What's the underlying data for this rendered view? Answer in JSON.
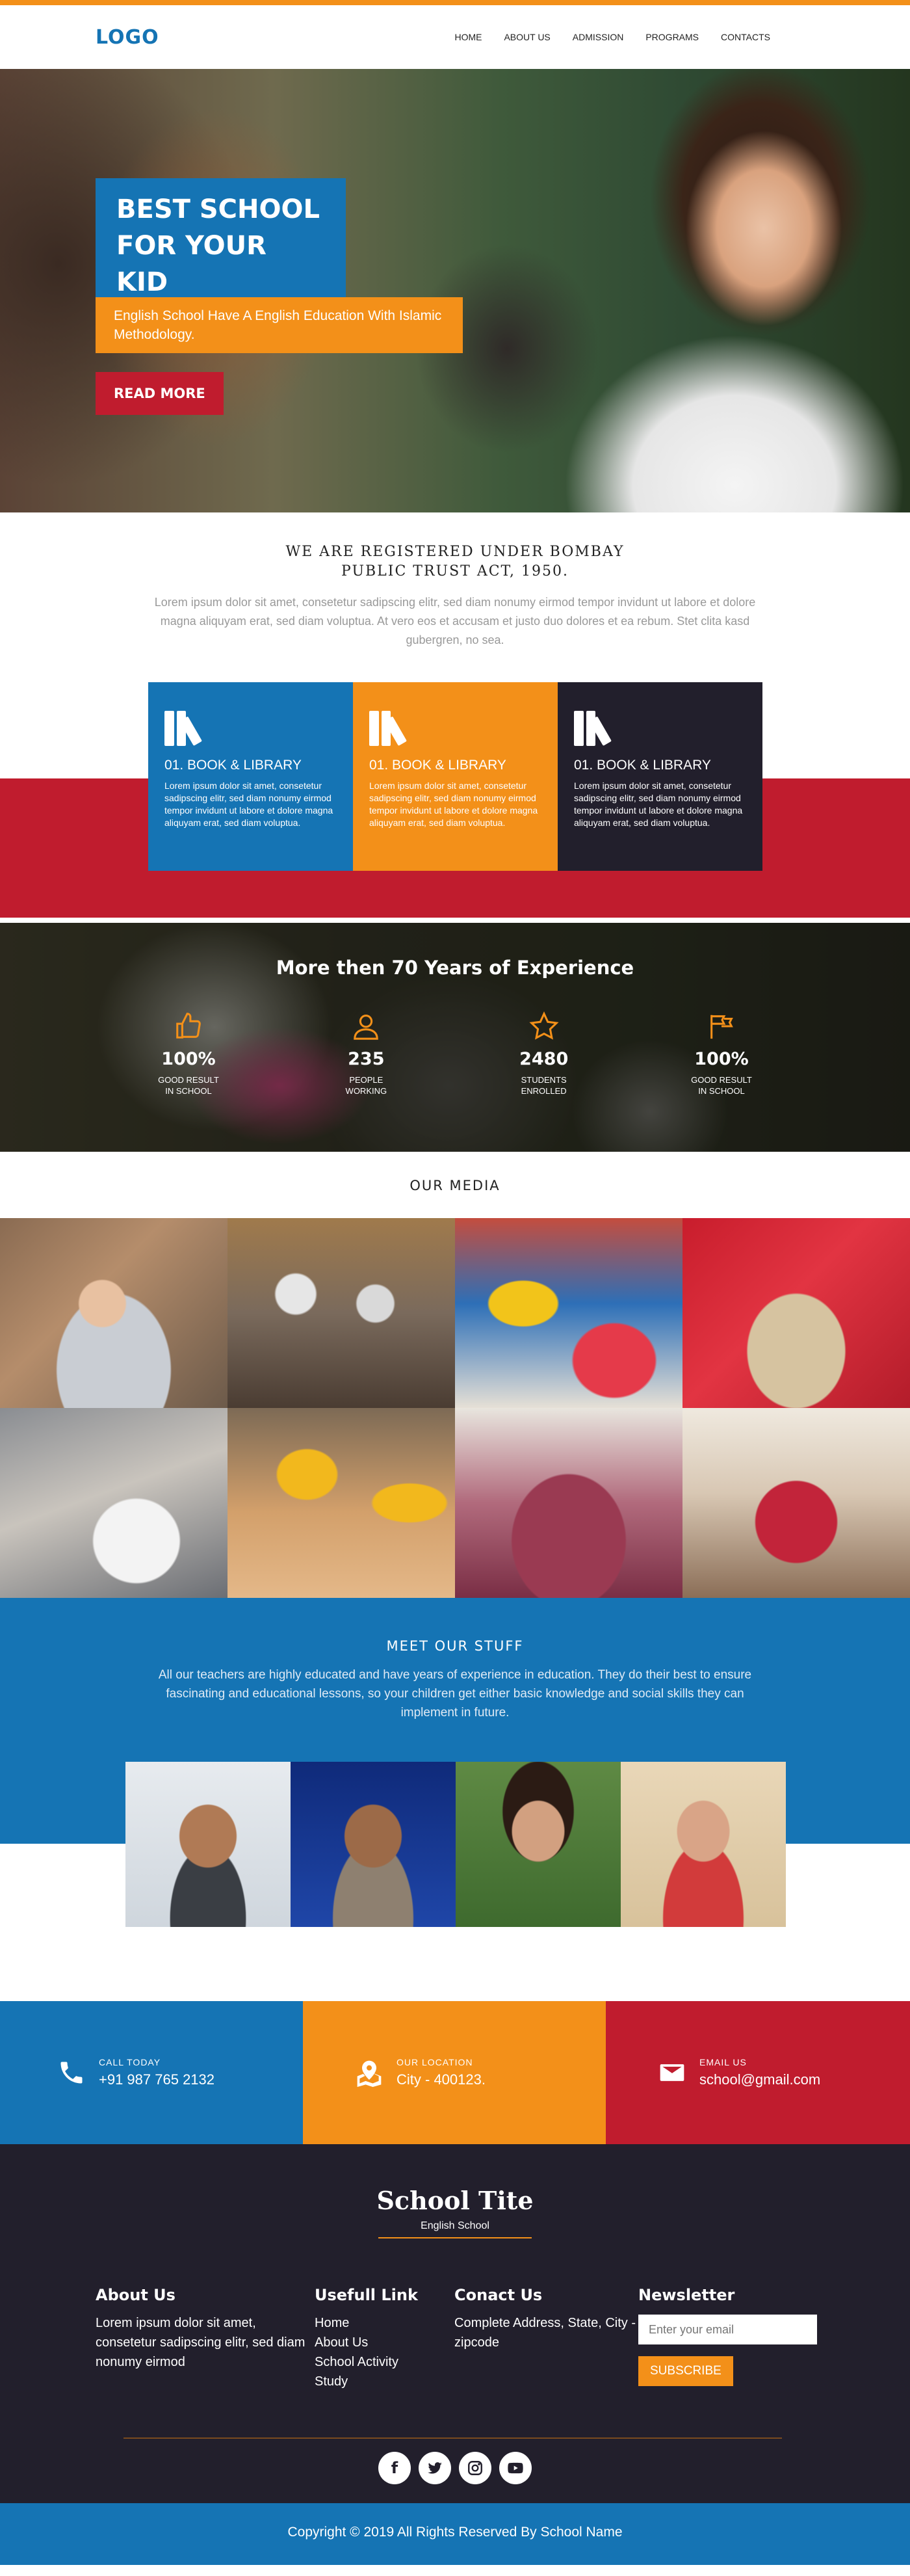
{
  "header": {
    "logo": "LOGO",
    "nav": [
      "HOME",
      "ABOUT US",
      "ADMISSION",
      "PROGRAMS",
      "CONTACTS"
    ]
  },
  "hero": {
    "title": "BEST SCHOOL FOR YOUR KID",
    "subtitle": "English School Have A English Education With Islamic Methodology.",
    "button": "READ MORE"
  },
  "register": {
    "heading": "WE ARE REGISTERED UNDER BOMBAY PUBLIC TRUST ACT, 1950.",
    "text": "Lorem ipsum dolor sit amet, consetetur sadipscing elitr, sed diam nonumy eirmod tempor invidunt ut labore et dolore magna aliquyam erat, sed diam voluptua. At vero eos et accusam et justo duo dolores et ea rebum. Stet clita kasd gubergren, no sea."
  },
  "features": [
    {
      "title": "01. BOOK & LIBRARY",
      "text": "Lorem ipsum dolor sit amet, consetetur sadipscing elitr, sed diam nonumy eirmod tempor invidunt ut labore et dolore magna aliquyam erat, sed diam voluptua.",
      "color": "#1574b4"
    },
    {
      "title": "01. BOOK & LIBRARY",
      "text": "Lorem ipsum dolor sit amet, consetetur sadipscing elitr, sed diam nonumy eirmod tempor invidunt ut labore et dolore magna aliquyam erat, sed diam voluptua.",
      "color": "#f39019"
    },
    {
      "title": "01. BOOK & LIBRARY",
      "text": "Lorem ipsum dolor sit amet, consetetur sadipscing elitr, sed diam nonumy eirmod tempor invidunt ut labore et dolore magna aliquyam erat, sed diam voluptua.",
      "color": "#221f2c"
    }
  ],
  "experience": {
    "heading": "More then 70 Years of Experience",
    "stats": [
      {
        "icon": "thumbs-up-icon",
        "value": "100%",
        "label_1": "GOOD RESULT",
        "label_2": "IN SCHOOL"
      },
      {
        "icon": "user-icon",
        "value": "235",
        "label_1": "PEOPLE",
        "label_2": "WORKING"
      },
      {
        "icon": "star-icon",
        "value": "2480",
        "label_1": "STUDENTS",
        "label_2": "ENROLLED"
      },
      {
        "icon": "flag-icon",
        "value": "100%",
        "label_1": "GOOD RESULT",
        "label_2": "IN SCHOOL"
      }
    ]
  },
  "media": {
    "heading": "OUR MEDIA"
  },
  "staff": {
    "heading": "MEET OUR STUFF",
    "text": "All our teachers are highly educated and have years of experience in education. They do their best to ensure fascinating and educational lessons, so your children get either basic knowledge and social skills they can implement in future."
  },
  "contact": [
    {
      "icon": "phone-icon",
      "label": "CALL TODAY",
      "value": "+91 987 765 2132"
    },
    {
      "icon": "map-pin-icon",
      "label": "OUR LOCATION",
      "value": "City - 400123."
    },
    {
      "icon": "mail-icon",
      "label": "EMAIL US",
      "value": "school@gmail.com"
    }
  ],
  "footer": {
    "brand_name": "School Tite",
    "brand_tag": "English School",
    "about_heading": "About Us",
    "about_text": "Lorem ipsum dolor sit amet, consetetur sadipscing elitr, sed diam nonumy eirmod",
    "links_heading": "Usefull Link",
    "links": [
      "Home",
      "About Us",
      "School Activity",
      "Study"
    ],
    "contact_heading": "Conact Us",
    "contact_text": "Complete Address, State, City - zipcode",
    "newsletter_heading": "Newsletter",
    "newsletter_placeholder": "Enter your email",
    "subscribe": "SUBSCRIBE",
    "socials": [
      "facebook-icon",
      "twitter-icon",
      "instagram-icon",
      "youtube-icon"
    ],
    "copyright": "Copyright © 2019 All Rights Reserved By School Name"
  },
  "colors": {
    "blue": "#1574b4",
    "orange": "#f39019",
    "red": "#c01c2e",
    "dark": "#221f2c"
  }
}
